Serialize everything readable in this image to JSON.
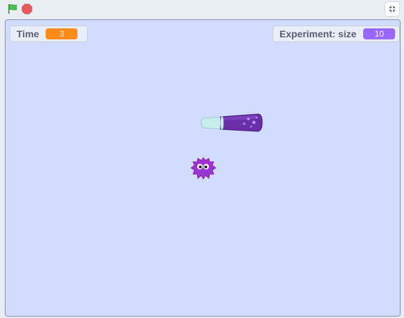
{
  "controls": {
    "green_flag": "green-flag-icon",
    "stop": "stop-sign-icon",
    "fullscreen": "fullscreen-icon"
  },
  "monitors": {
    "time": {
      "label": "Time",
      "value": "3",
      "color": "#ff8c1a"
    },
    "size": {
      "label": "Experiment: size",
      "value": "10",
      "color": "#9966ff"
    }
  },
  "sprites": {
    "test_tube": "test-tube-sprite",
    "blob": "purple-blob-sprite"
  },
  "colors": {
    "stage_background": "#d2dcff",
    "time_value_bg": "#ff8c1a",
    "size_value_bg": "#9966ff"
  }
}
